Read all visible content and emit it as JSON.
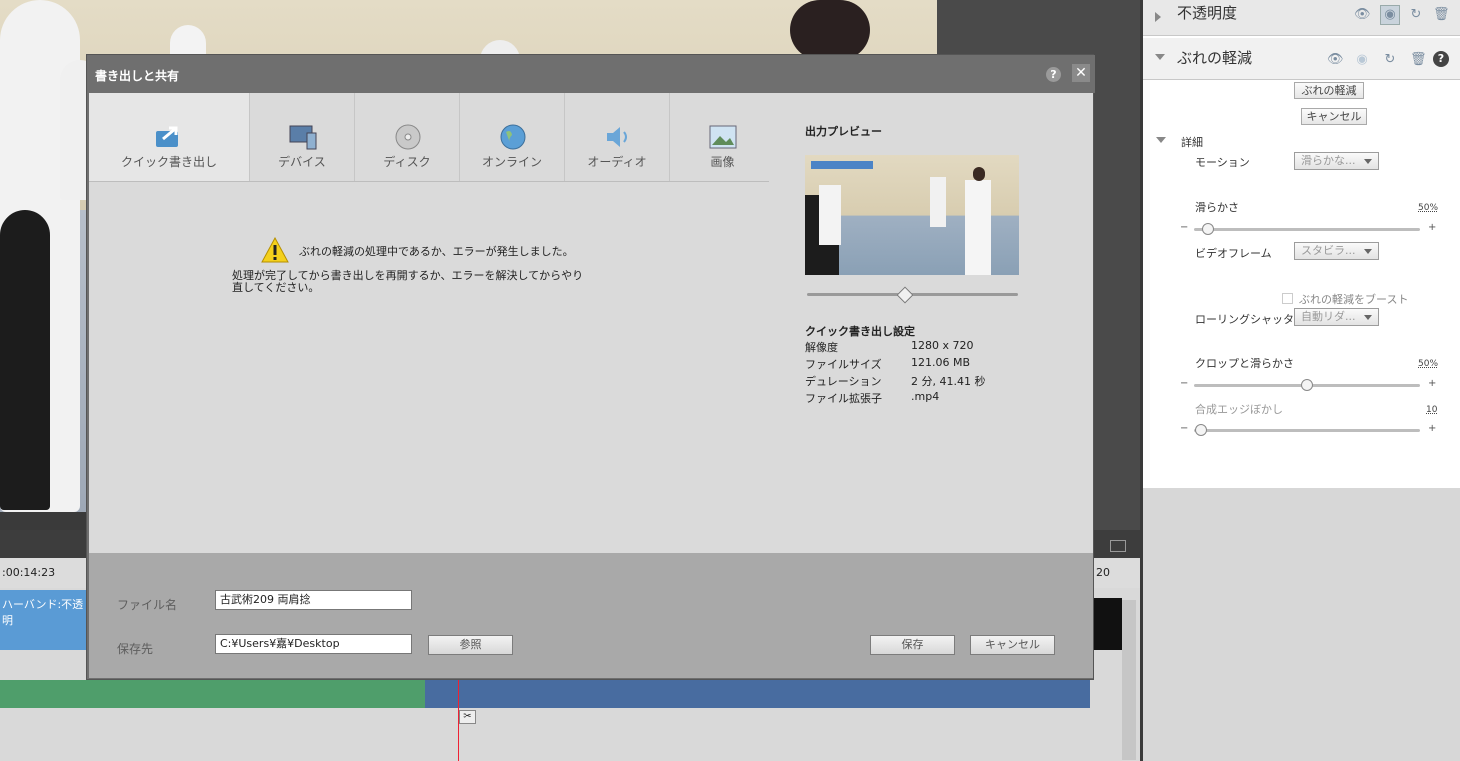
{
  "dialog": {
    "title": "書き出しと共有",
    "help": "?",
    "close": "✕",
    "tabs": [
      {
        "label": "クイック書き出し",
        "icon": "quick-export-icon"
      },
      {
        "label": "デバイス",
        "icon": "device-icon"
      },
      {
        "label": "ディスク",
        "icon": "disc-icon"
      },
      {
        "label": "オンライン",
        "icon": "globe-icon"
      },
      {
        "label": "オーディオ",
        "icon": "speaker-icon"
      },
      {
        "label": "画像",
        "icon": "image-icon"
      }
    ],
    "warning": {
      "line1": "ぶれの軽減の処理中であるか、エラーが発生しました。",
      "line2": "処理が完了してから書き出しを再開するか、エラーを解決してからやり直してください。"
    },
    "preview": {
      "title": "出力プレビュー",
      "settings_title": "クイック書き出し設定",
      "rows": [
        {
          "key": "解像度",
          "value": "1280 x 720"
        },
        {
          "key": "ファイルサイズ",
          "value": "121.06 MB"
        },
        {
          "key": "デュレーション",
          "value": "2 分, 41.41 秒"
        },
        {
          "key": "ファイル拡張子",
          "value": ".mp4"
        }
      ]
    },
    "footer": {
      "filename_label": "ファイル名",
      "filename_value": "古武術209 両肩捻",
      "save_to_label": "保存先",
      "save_to_value": "C:¥Users¥嘉¥Desktop",
      "browse": "参照",
      "save": "保存",
      "cancel": "キャンセル"
    }
  },
  "panel": {
    "opacity_title": "不透明度",
    "stabilize_title": "ぶれの軽減",
    "stabilize_button": "ぶれの軽減",
    "cancel_button": "キャンセル",
    "details": "詳細",
    "motion_label": "モーション",
    "motion_value": "滑らかな...",
    "smoothness_label": "滑らかさ",
    "smoothness_pct": "50%",
    "video_frame_label": "ビデオフレーム",
    "video_frame_value": "スタビラ...",
    "boost_label": "ぶれの軽減をブースト",
    "rolling_label": "ローリングシャッター...",
    "rolling_value": "自動リダ...",
    "crop_label": "クロップと滑らかさ",
    "crop_pct": "50%",
    "edge_label": "合成エッジぼかし",
    "edge_value": "10",
    "minus": "−",
    "plus": "+"
  },
  "timeline": {
    "timecode": ":00:14:23",
    "clip_label": "ハーバンド:不透明",
    "right_code": "20"
  }
}
